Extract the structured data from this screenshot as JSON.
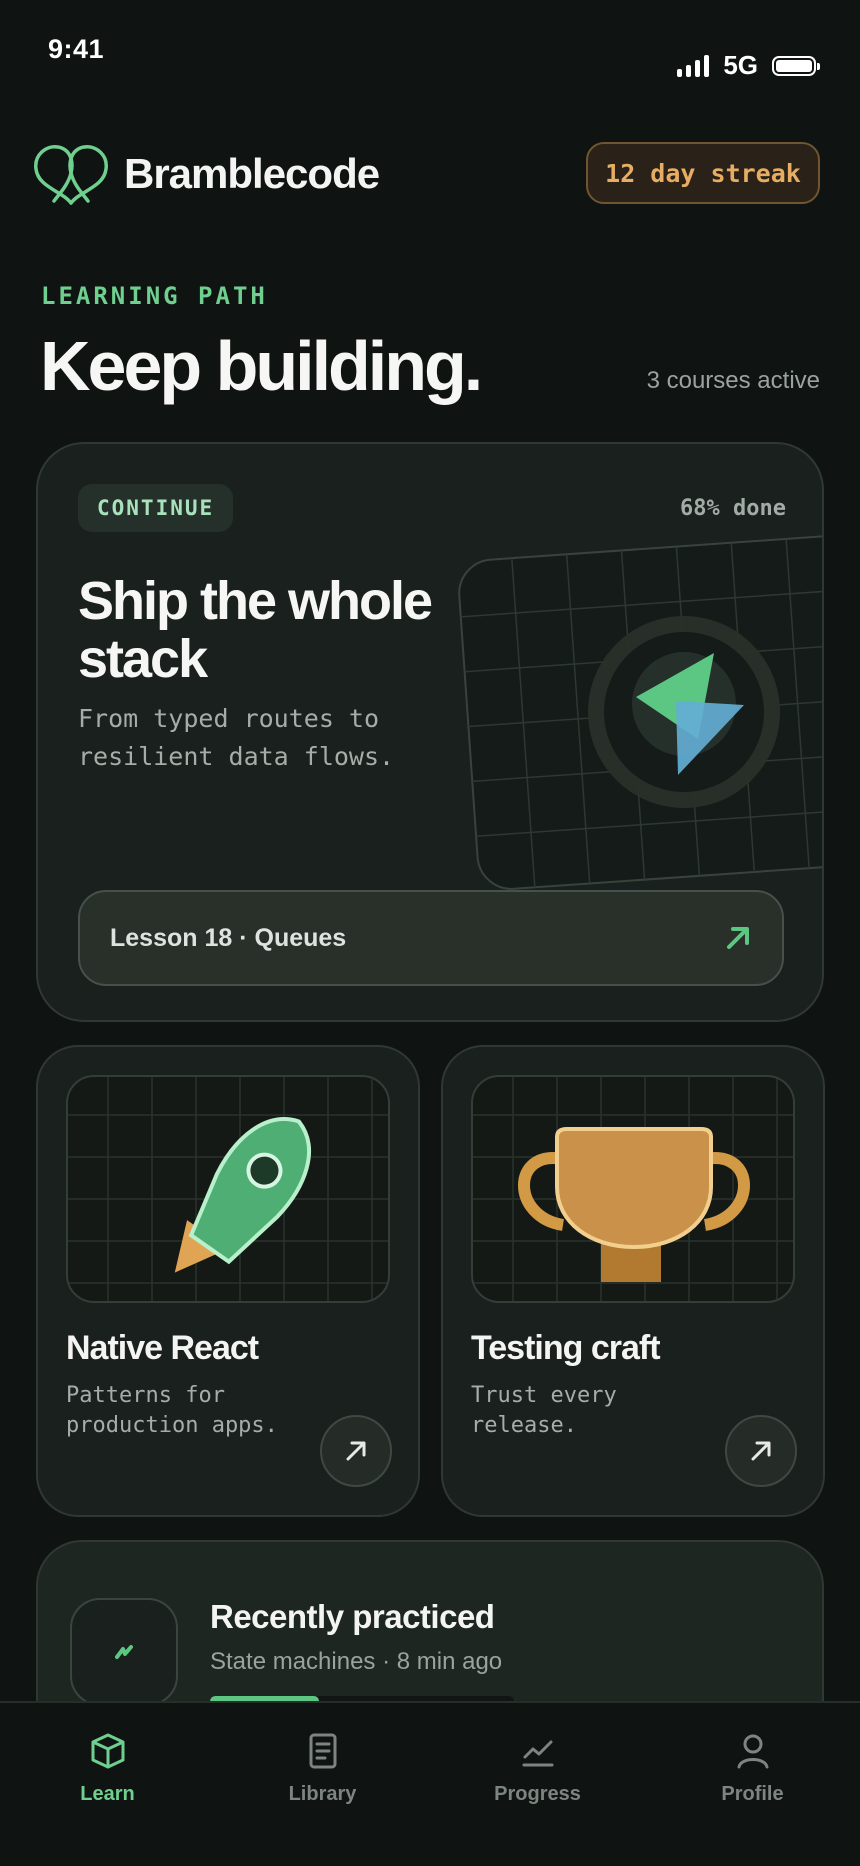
{
  "status": {
    "time": "9:41",
    "network": "5G"
  },
  "brand": {
    "name": "Bramblecode"
  },
  "streak": {
    "label": "12 day streak"
  },
  "section": {
    "eyebrow": "LEARNING PATH",
    "headline": "Keep building.",
    "active_courses": "3 courses active"
  },
  "hero": {
    "chip": "CONTINUE",
    "progress": "68% done",
    "title": "Ship the whole stack",
    "subtitle": "From typed routes to resilient data flows.",
    "lesson": "Lesson 18 · Queues"
  },
  "courses": [
    {
      "title": "Native React",
      "subtitle": "Patterns for production apps."
    },
    {
      "title": "Testing craft",
      "subtitle": "Trust every release."
    }
  ],
  "recent": {
    "title": "Recently practiced",
    "subtitle": "State machines · 8 min ago",
    "progress": 0.36
  },
  "tabs": [
    {
      "label": "Learn",
      "icon": "cube-icon",
      "active": true
    },
    {
      "label": "Library",
      "icon": "document-icon",
      "active": false
    },
    {
      "label": "Progress",
      "icon": "chart-icon",
      "active": false
    },
    {
      "label": "Profile",
      "icon": "person-icon",
      "active": false
    }
  ],
  "colors": {
    "accent": "#6fcf8e",
    "streak": "#e7ad63",
    "background": "#0f1412"
  }
}
